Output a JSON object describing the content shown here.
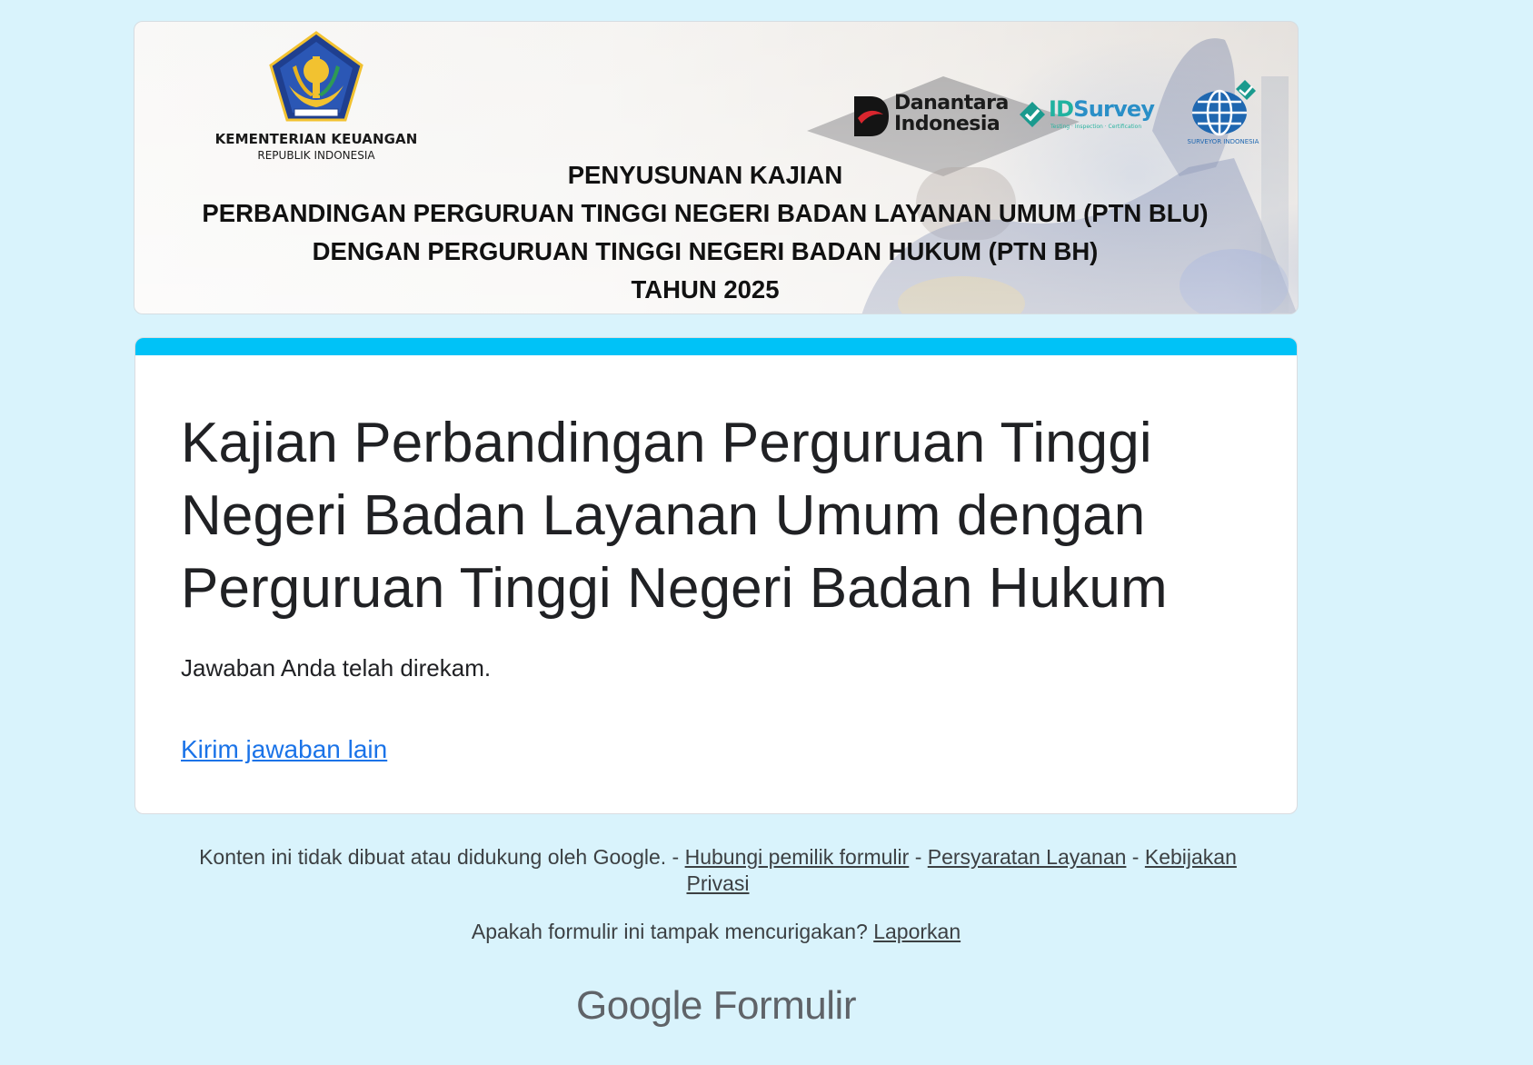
{
  "banner": {
    "ministry_name": "KEMENTERIAN KEUANGAN",
    "ministry_sub": "REPUBLIK INDONESIA",
    "partners": {
      "danantara_line1": "Danantara",
      "danantara_line2": "Indonesia",
      "idsurvey_id": "ID",
      "idsurvey_rest": "Survey",
      "idsurvey_tagline": "Testing · Inspection · Certification",
      "surveyor": "SURVEYOR INDONESIA"
    },
    "title_lines": [
      "PENYUSUNAN KAJIAN",
      "PERBANDINGAN PERGURUAN TINGGI NEGERI BADAN LAYANAN UMUM (PTN BLU)",
      "DENGAN PERGURUAN TINGGI NEGERI BADAN HUKUM (PTN BH)",
      "TAHUN 2025"
    ]
  },
  "form": {
    "title": "Kajian Perbandingan Perguruan Tinggi Negeri Badan Layanan Umum dengan Perguruan Tinggi Negeri Badan Hukum",
    "confirmation": "Jawaban Anda telah direkam.",
    "another_response_link": "Kirim jawaban lain"
  },
  "footer": {
    "disclaimer": "Konten ini tidak dibuat atau didukung oleh Google.",
    "separator": " - ",
    "contact_owner": "Hubungi pemilik formulir",
    "terms": "Persyaratan Layanan",
    "privacy": "Kebijakan Privasi",
    "report_question": "Apakah formulir ini tampak mencurigakan?",
    "report_link": "Laporkan",
    "brand_google": "Google",
    "brand_forms": "Formulir"
  },
  "colors": {
    "page_bg": "#d9f3fc",
    "accent": "#00c2f7",
    "link": "#1a73e8"
  }
}
